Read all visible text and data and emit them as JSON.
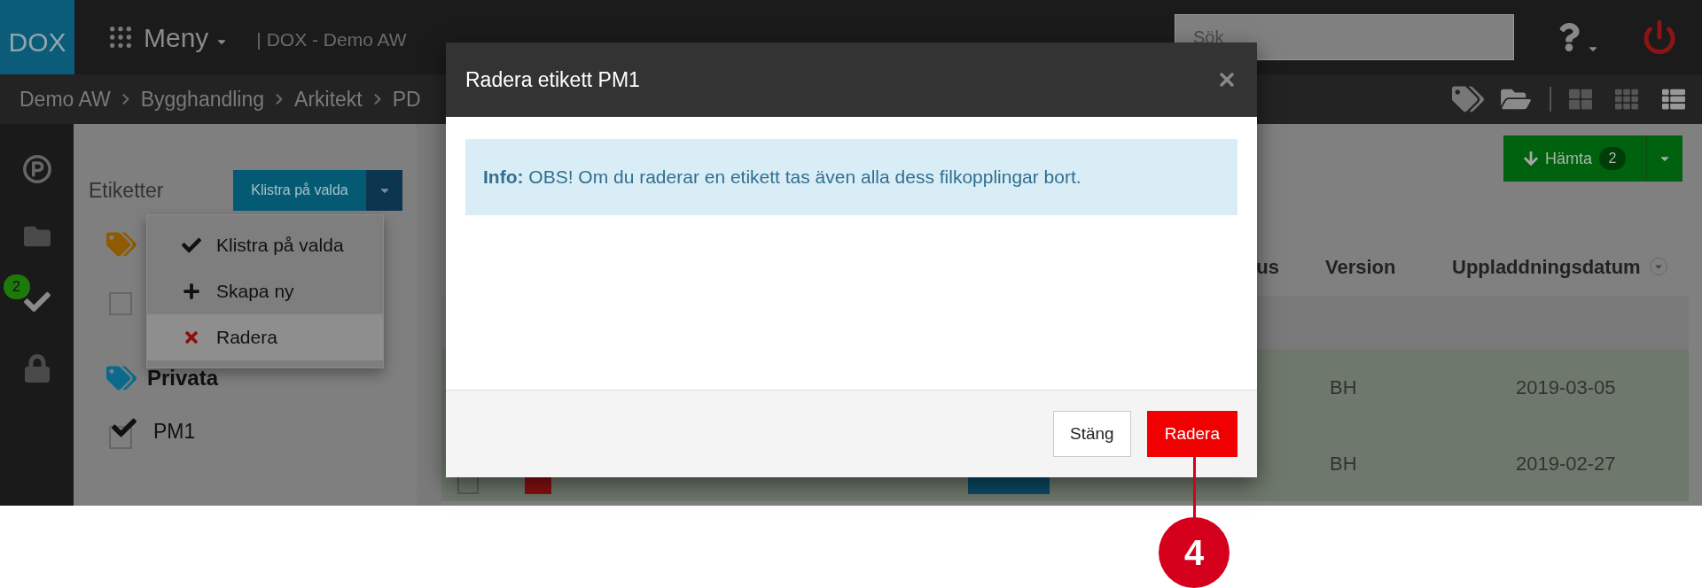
{
  "topbar": {
    "logo": "DOX",
    "menu": "Meny",
    "site": "| DOX - Demo AW",
    "search": {
      "placeholder": "Sök"
    }
  },
  "breadcrumb": [
    "Demo AW",
    "Bygghandling",
    "Arkitekt",
    "PD"
  ],
  "sidebar": {
    "badge": "2"
  },
  "labels_panel": {
    "title": "Etiketter",
    "button": "Klistra på valda",
    "menu": [
      {
        "kind": "check",
        "label": "Klistra på valda",
        "selected": false
      },
      {
        "kind": "plus",
        "label": "Skapa ny",
        "selected": false
      },
      {
        "kind": "delete",
        "label": "Radera",
        "selected": true
      }
    ],
    "groups": [
      {
        "color": "#8f5a00",
        "items": [
          {
            "checked": false
          }
        ]
      },
      {
        "name": "Privata",
        "color": "#0b6a8c",
        "items": [
          {
            "label": "PM1",
            "checked": true
          }
        ]
      }
    ]
  },
  "download": {
    "label": "Hämta",
    "count": "2"
  },
  "table": {
    "columns": [
      "us",
      "Version",
      "Uppladdningsdatum"
    ],
    "rows": [
      {
        "version": "BH",
        "date": "2019-03-05"
      },
      {
        "version": "BH",
        "date": "2019-02-27",
        "checked": false
      }
    ]
  },
  "modal": {
    "title": "Radera etikett PM1",
    "info": "**Info:** OBS! Om du raderar en etikett tas även alla dess filkopplingar bort.",
    "buttons": [
      {
        "kind": "default",
        "label": "Stäng"
      },
      {
        "kind": "danger",
        "label": "Radera"
      }
    ]
  },
  "callout": {
    "number": "4"
  }
}
